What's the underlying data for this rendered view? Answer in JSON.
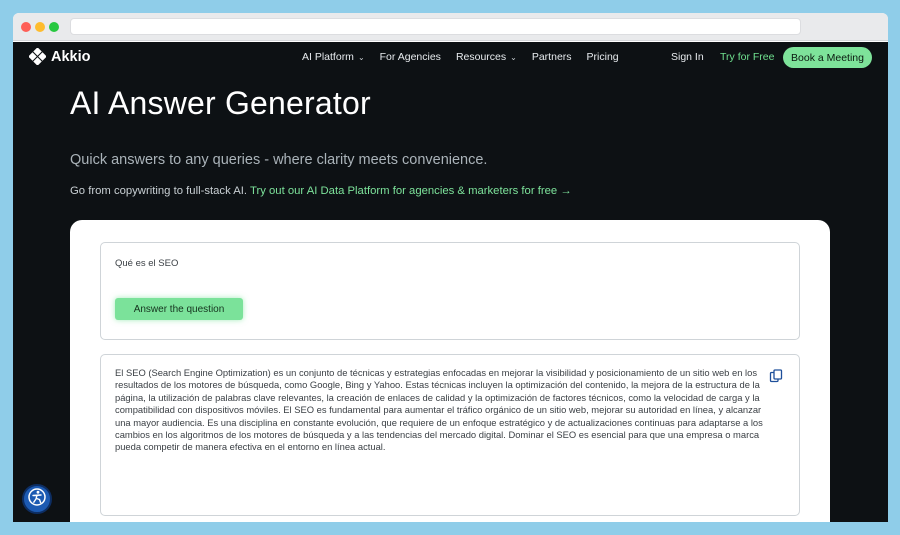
{
  "nav": {
    "brand": "Akkio",
    "links": [
      {
        "label": "AI Platform",
        "has_menu": true
      },
      {
        "label": "For Agencies",
        "has_menu": false
      },
      {
        "label": "Resources",
        "has_menu": true
      },
      {
        "label": "Partners",
        "has_menu": false
      },
      {
        "label": "Pricing",
        "has_menu": false
      }
    ],
    "sign_in": "Sign In",
    "try_free": "Try for Free",
    "book_meeting": "Book a Meeting"
  },
  "hero": {
    "title": "AI Answer Generator",
    "subtitle": "Quick answers to any queries - where clarity meets convenience.",
    "line_plain": "Go from copywriting to full-stack AI.",
    "line_link": "Try out our AI Data Platform for agencies & marketers for free →"
  },
  "tool": {
    "question": "Qué es el SEO",
    "answer_button": "Answer the question",
    "answer": "El SEO (Search Engine Optimization) es un conjunto de técnicas y estrategias enfocadas en mejorar la visibilidad y posicionamiento de un sitio web en los resultados de los motores de búsqueda, como Google, Bing y Yahoo. Estas técnicas incluyen la optimización del contenido, la mejora de la estructura de la página, la utilización de palabras clave relevantes, la creación de enlaces de calidad y la optimización de factores técnicos, como la velocidad de carga y la compatibilidad con dispositivos móviles. El SEO es fundamental para aumentar el tráfico orgánico de un sitio web, mejorar su autoridad en línea, y alcanzar una mayor audiencia. Es una disciplina en constante evolución, que requiere de un enfoque estratégico y de actualizaciones continuas para adaptarse a los cambios en los algoritmos de los motores de búsqueda y a las tendencias del mercado digital. Dominar el SEO es esencial para que una empresa o marca pueda competir de manera efectiva en el entorno en línea actual."
  },
  "icons": {
    "logo": "akkio-logo-icon",
    "copy": "copy-icon",
    "accessibility": "accessibility-icon"
  },
  "colors": {
    "page_bg": "#0d1114",
    "accent_green": "#7be29a",
    "link_green": "#7de39b"
  }
}
